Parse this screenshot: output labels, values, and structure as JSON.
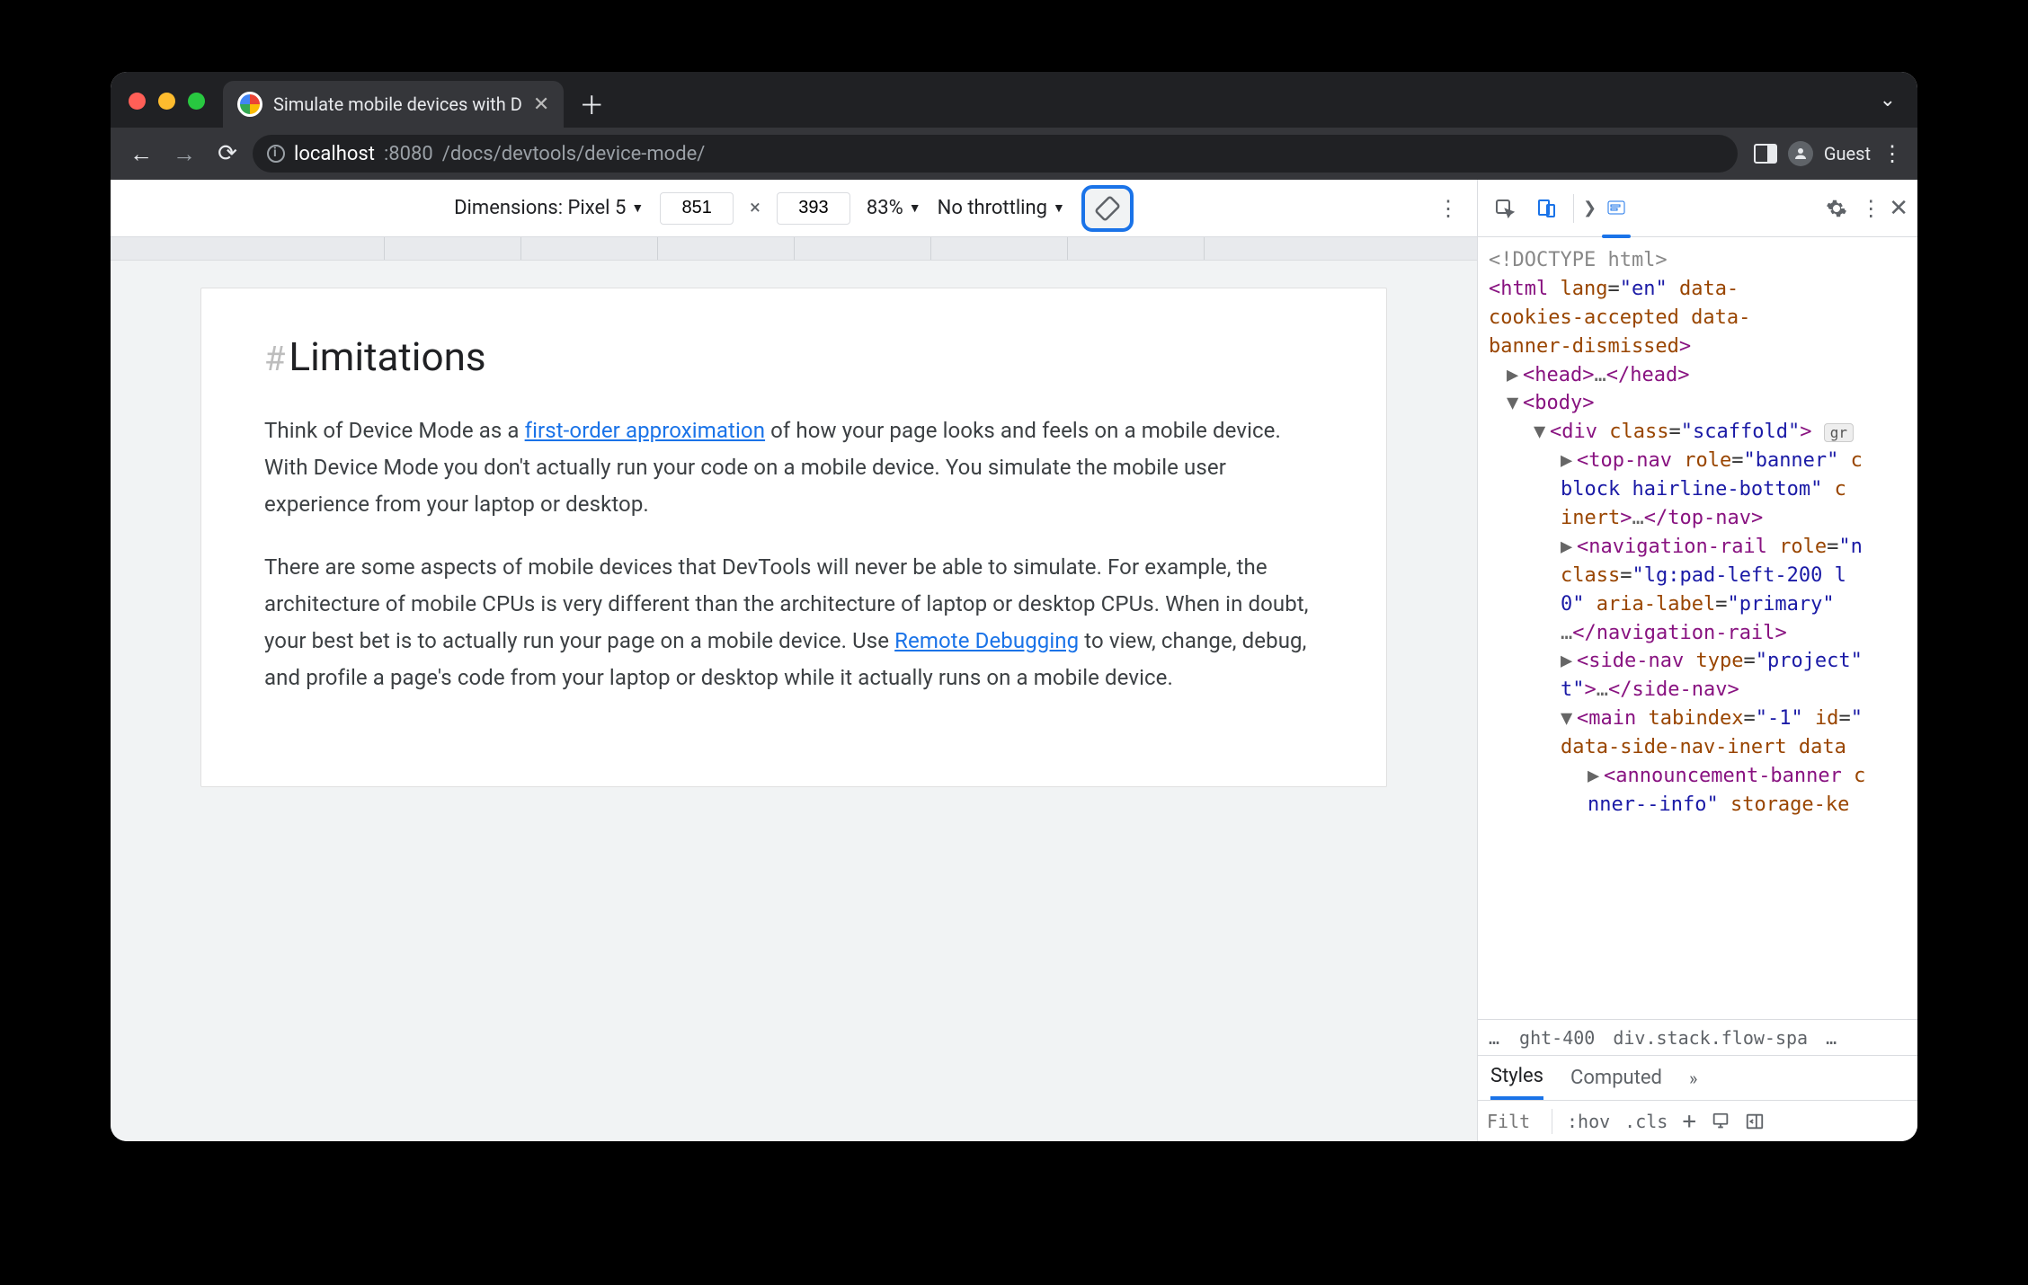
{
  "tab": {
    "title": "Simulate mobile devices with D"
  },
  "omnibox": {
    "host": "localhost",
    "port": ":8080",
    "path": "/docs/devtools/device-mode/",
    "guest": "Guest"
  },
  "deviceToolbar": {
    "dimensionsLabel": "Dimensions: Pixel 5",
    "width": "851",
    "height": "393",
    "zoom": "83%",
    "throttling": "No throttling"
  },
  "page": {
    "heading": "Limitations",
    "p1_a": "Think of Device Mode as a ",
    "p1_link": "first-order approximation",
    "p1_b": " of how your page looks and feels on a mobile device. With Device Mode you don't actually run your code on a mobile device. You simulate the mobile user experience from your laptop or desktop.",
    "p2_a": "There are some aspects of mobile devices that DevTools will never be able to simulate. For example, the architecture of mobile CPUs is very different than the architecture of laptop or desktop CPUs. When in doubt, your best bet is to actually run your page on a mobile device. Use ",
    "p2_link": "Remote Debugging",
    "p2_b": " to view, change, debug, and profile a page's code from your laptop or desktop while it actually runs on a mobile device."
  },
  "dom": {
    "doctype": "<!DOCTYPE html>",
    "html_open": "<html lang=\"en\" data-cookies-accepted data-banner-dismissed>",
    "lines": [
      "▶ <head>…</head>",
      "▼ <body>",
      "  ▼ <div class=\"scaffold\"> gr",
      "    ▶ <top-nav role=\"banner\" c block hairline-bottom\" c inert>…</top-nav>",
      "    ▶ <navigation-rail role=\"n class=\"lg:pad-left-200 l 0\" aria-label=\"primary\" …</navigation-rail>",
      "    ▶ <side-nav type=\"project\" t\">…</side-nav>",
      "    ▼ <main tabindex=\"-1\" id=\" data-side-nav-inert data",
      "      ▶ <announcement-banner c nner--info\" storage-ke"
    ]
  },
  "crumbs": {
    "a": "ght-400",
    "b": "div.stack.flow-spa"
  },
  "styleTabs": {
    "styles": "Styles",
    "computed": "Computed"
  },
  "filterRow": {
    "placeholder": "Filt",
    "hov": ":hov",
    "cls": ".cls"
  }
}
